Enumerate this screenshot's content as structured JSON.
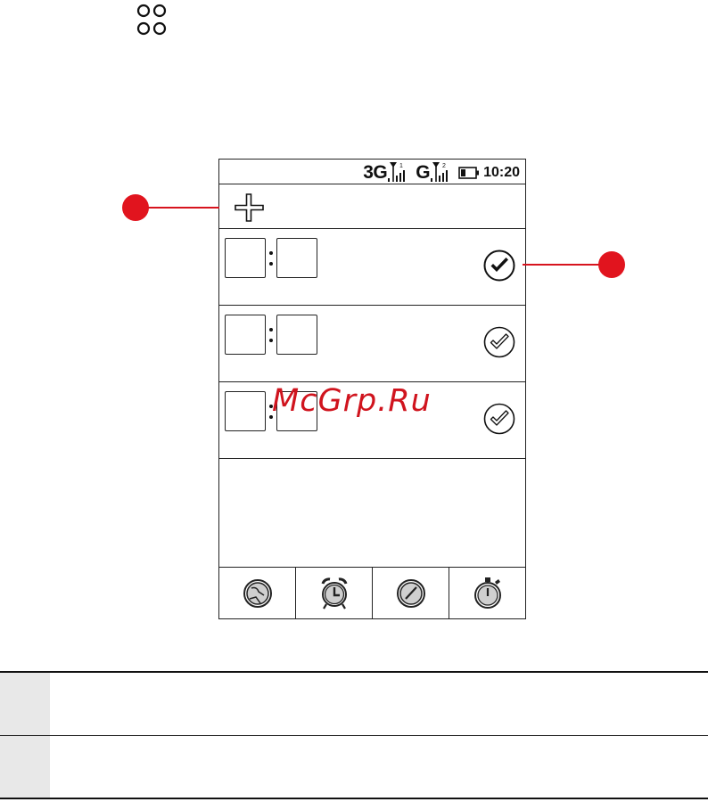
{
  "header": {
    "menu_icon": "four-circles-menu-icon"
  },
  "status_bar": {
    "network_1": "3G",
    "sim_1_index": "1",
    "network_2": "G",
    "sim_2_index": "2",
    "battery_icon": "battery-icon",
    "time": "10:20"
  },
  "toolbar": {
    "add_icon": "plus-icon"
  },
  "alarms": [
    {
      "enabled": true,
      "check_icon": "check-filled-icon"
    },
    {
      "enabled": false,
      "check_icon": "check-outline-icon"
    },
    {
      "enabled": false,
      "check_icon": "check-outline-icon"
    }
  ],
  "tabs": [
    {
      "icon": "world-clock-icon"
    },
    {
      "icon": "alarm-clock-icon"
    },
    {
      "icon": "timer-icon"
    },
    {
      "icon": "stopwatch-icon"
    }
  ],
  "watermark": "McGrp.Ru",
  "colors": {
    "callout": "#e1141e",
    "border": "#222222",
    "legend_cell": "#e8e8e8"
  },
  "legend": [
    {
      "text": ""
    },
    {
      "text": ""
    }
  ]
}
